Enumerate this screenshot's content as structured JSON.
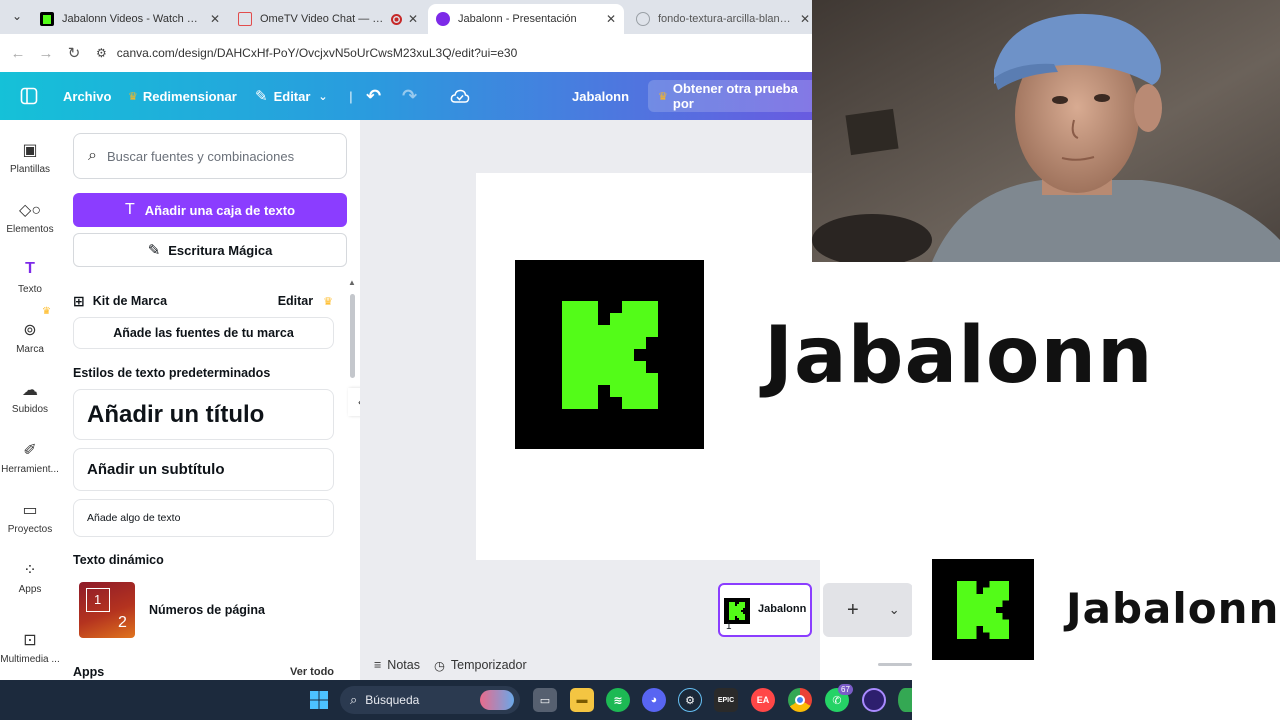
{
  "browser": {
    "tabs": [
      {
        "label": "Jabalonn Videos - Watch On-De",
        "favicon_color": "#53fc18"
      },
      {
        "label": "OmeTV Video Chat — Ome",
        "favicon_color": "#e24c4c"
      },
      {
        "label": "Jabalonn - Presentación",
        "favicon_color": "#7d2ae8"
      },
      {
        "label": "fondo-textura-arcilla-blanca-es",
        "favicon_color": "#9aa0a6"
      }
    ],
    "url": "canva.com/design/DAHCxHf-PoY/OvcjxvN5oUrCwsM23xuL3Q/edit?ui=e30"
  },
  "header": {
    "file_label": "Archivo",
    "resize_label": "Redimensionar",
    "edit_label": "Editar",
    "design_name": "Jabalonn",
    "trial_label": "Obtener otra prueba por"
  },
  "rail": {
    "items": [
      {
        "label": "Plantillas",
        "icon": "template-icon"
      },
      {
        "label": "Elementos",
        "icon": "elements-icon"
      },
      {
        "label": "Texto",
        "icon": "text-icon"
      },
      {
        "label": "Marca",
        "icon": "brand-icon"
      },
      {
        "label": "Subidos",
        "icon": "upload-icon"
      },
      {
        "label": "Herramient...",
        "icon": "tools-icon"
      },
      {
        "label": "Proyectos",
        "icon": "folder-icon"
      },
      {
        "label": "Apps",
        "icon": "apps-icon"
      },
      {
        "label": "Multimedia ...",
        "icon": "media-icon"
      }
    ]
  },
  "panel": {
    "search_placeholder": "Buscar fuentes y combinaciones",
    "add_text_box": "Añadir una caja de texto",
    "magic_write": "Escritura Mágica",
    "brand_kit": "Kit de Marca",
    "brand_edit": "Editar",
    "add_brand_fonts": "Añade las fuentes de tu marca",
    "default_styles_title": "Estilos de texto predeterminados",
    "add_title": "Añadir un título",
    "add_subtitle": "Añadir un subtítulo",
    "add_body": "Añade algo de texto",
    "dynamic_text_title": "Texto dinámico",
    "page_numbers": "Números de página",
    "page_number_sample_1": "1",
    "page_number_sample_2": "2",
    "apps_title": "Apps",
    "see_all": "Ver todo"
  },
  "canvas": {
    "slide_title": "Jabalonn",
    "logo_color": "#53fc18"
  },
  "pages": {
    "thumb_label": "Jabalonn",
    "thumb_number": "1"
  },
  "footer": {
    "notes": "Notas",
    "timer": "Temporizador"
  },
  "overlay": {
    "title": "Jabalonn"
  },
  "taskbar": {
    "search_label": "Búsqueda",
    "whatsapp_badge": "67"
  }
}
